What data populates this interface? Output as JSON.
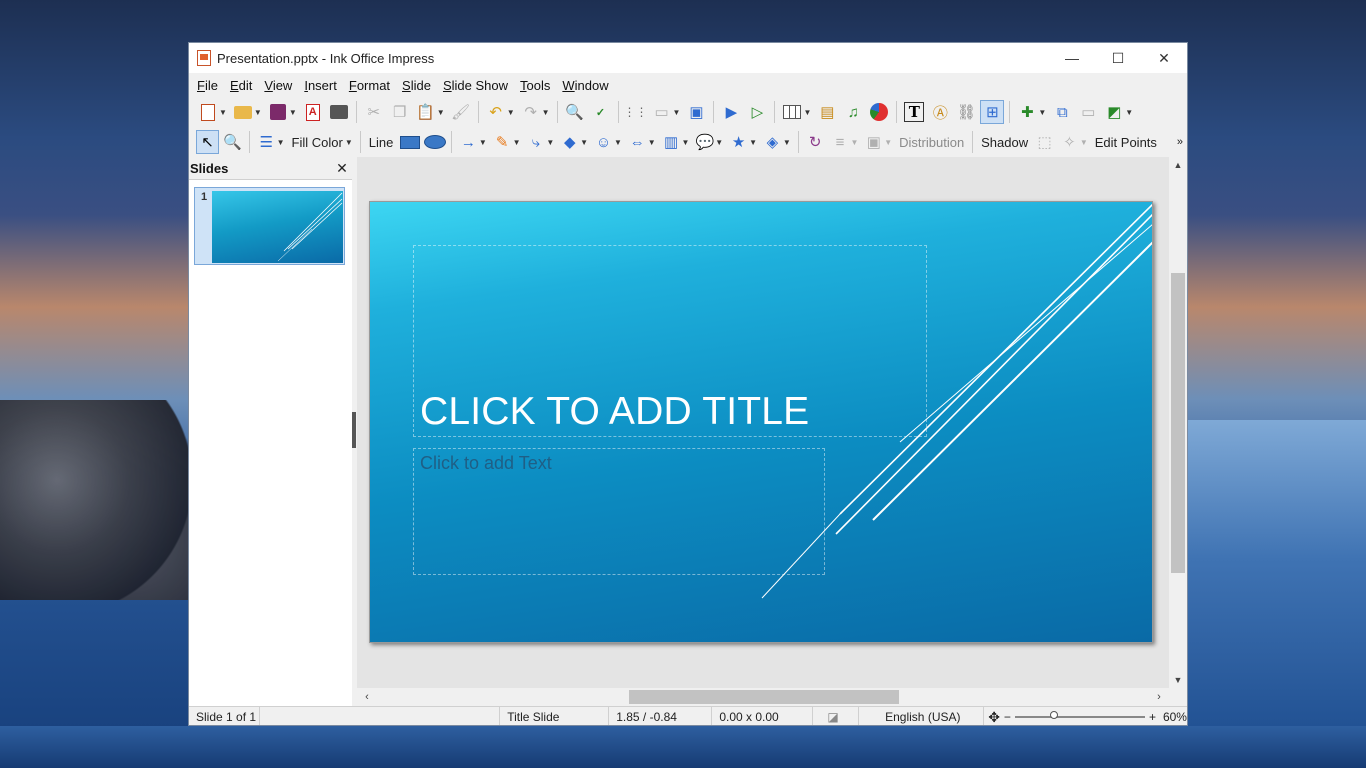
{
  "window": {
    "title": "Presentation.pptx - Ink Office Impress"
  },
  "window_controls": {
    "minimize": "—",
    "maximize": "☐",
    "close": "✕"
  },
  "menu": [
    {
      "label": "File",
      "underline": "F",
      "rest": "ile"
    },
    {
      "label": "Edit",
      "underline": "E",
      "rest": "dit"
    },
    {
      "label": "View",
      "underline": "V",
      "rest": "iew"
    },
    {
      "label": "Insert",
      "underline": "I",
      "rest": "nsert"
    },
    {
      "label": "Format",
      "underline": "F",
      "rest": "ormat"
    },
    {
      "label": "Slide",
      "underline": "S",
      "rest": "lide"
    },
    {
      "label": "Slide Show",
      "underline": "S",
      "rest": "lide Show"
    },
    {
      "label": "Tools",
      "underline": "T",
      "rest": "ools"
    },
    {
      "label": "Window",
      "underline": "W",
      "rest": "indow"
    }
  ],
  "toolbar2": {
    "fill_color": "Fill Color",
    "line": "Line",
    "distribution": "Distribution",
    "shadow": "Shadow",
    "edit_points": "Edit Points",
    "overflow": "»"
  },
  "slides_panel": {
    "title": "Slides",
    "close": "✕",
    "thumb_number": "1"
  },
  "slide": {
    "title_placeholder": "CLICK TO ADD TITLE",
    "body_placeholder": "Click to add Text"
  },
  "scroll": {
    "up": "▲",
    "down": "▼",
    "left": "‹",
    "right": "›"
  },
  "status": {
    "slide_of": "Slide 1 of 1",
    "layout": "Title Slide",
    "position": "1.85 / -0.84",
    "size": "0.00 x 0.00",
    "language": "English (USA)",
    "zoom_minus": "−",
    "zoom_plus": "+",
    "zoom": "60%",
    "zoom_level_fraction": 0.3
  },
  "colors": {
    "slide_top": "#3dd6f2",
    "slide_bottom": "#0a6aa6",
    "accent": "#2f6bd0"
  }
}
